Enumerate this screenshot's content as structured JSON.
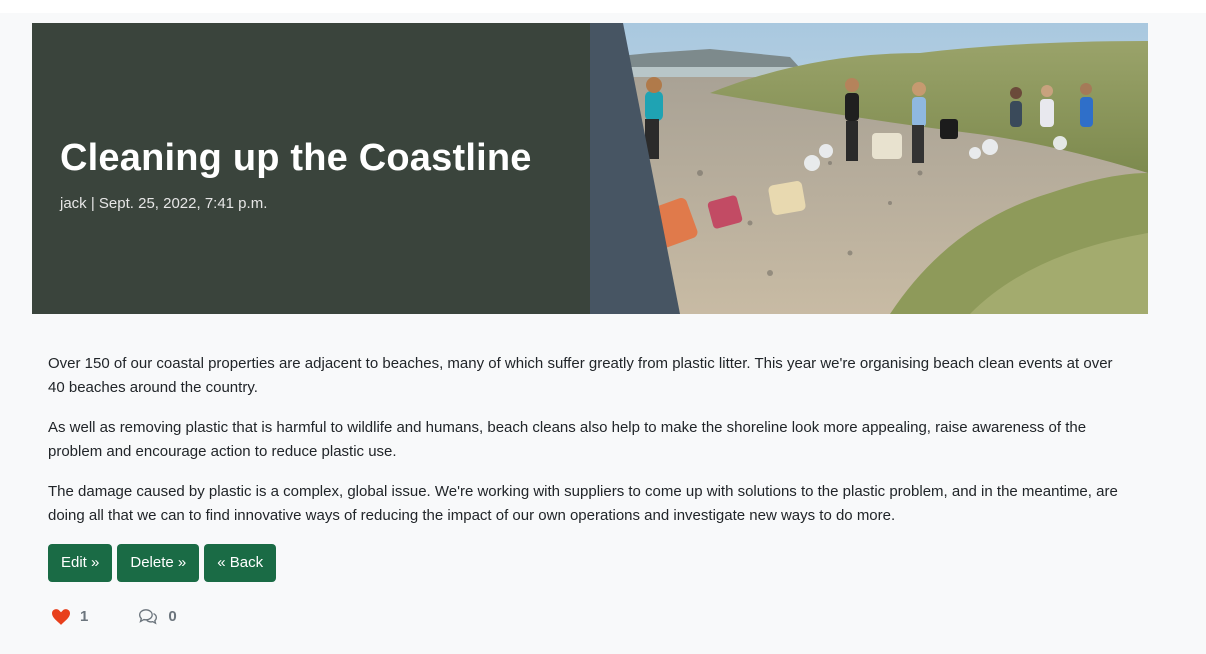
{
  "post": {
    "title": "Cleaning up the Coastline",
    "author": "jack",
    "date": "Sept. 25, 2022, 7:41 p.m.",
    "meta": "jack | Sept. 25, 2022, 7:41 p.m.",
    "image_description": "volunteers collecting plastic litter on a beach with dunes",
    "paragraphs": [
      "Over 150 of our coastal properties are adjacent to beaches, many of which suffer greatly from plastic litter. This year we're organising beach clean events at over 40 beaches around the country.",
      "As well as removing plastic that is harmful to wildlife and humans, beach cleans also help to make the shoreline look more appealing, raise awareness of the problem and encourage action to reduce plastic use.",
      "The damage caused by plastic is a complex, global issue. We're working with suppliers to come up with solutions to the plastic problem, and in the meantime, are doing all that we can to find innovative ways of reducing the impact of our own operations and investigate new ways to do more."
    ]
  },
  "actions": {
    "edit_label": "Edit »",
    "delete_label": "Delete »",
    "back_label": "« Back"
  },
  "stats": {
    "likes": "1",
    "comments": "0",
    "like_icon": "heart-icon",
    "comment_icon": "comments-icon"
  },
  "colors": {
    "hero_bg": "#3a443c",
    "button_bg": "#1a6b45",
    "heart": "#e8401c"
  }
}
